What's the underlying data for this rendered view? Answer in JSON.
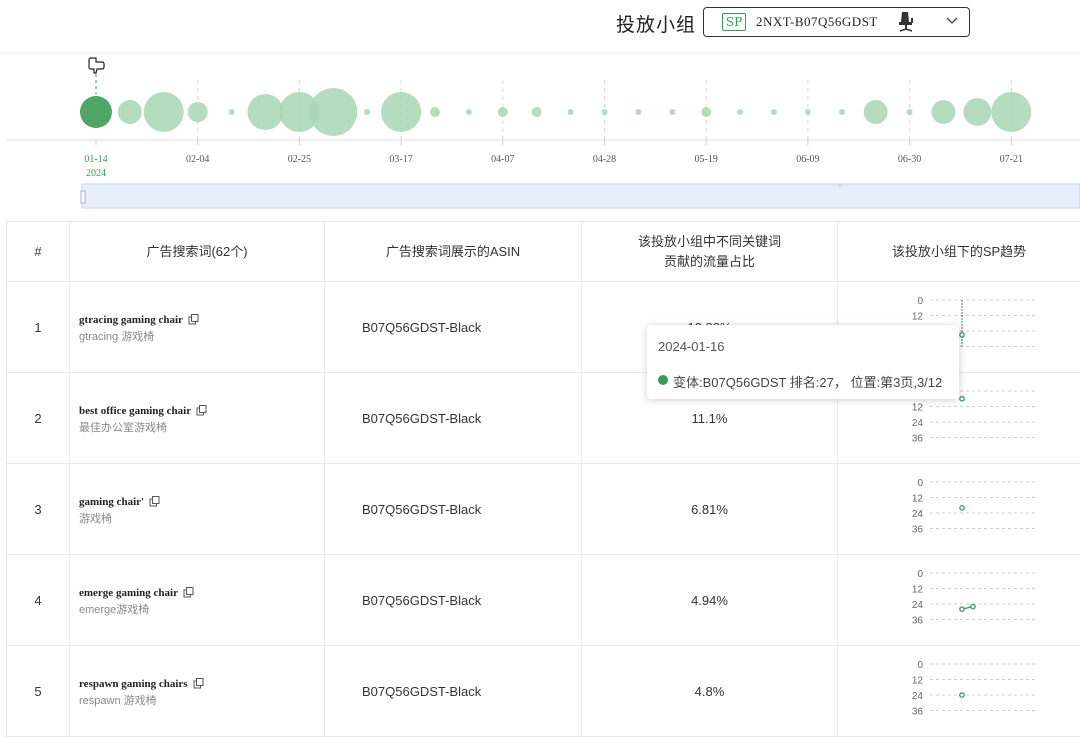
{
  "header": {
    "label": "投放小组",
    "group_badge": "SP",
    "group_name": "2NXT-B07Q56GDST",
    "group_icon": "gaming-chair-icon",
    "dropdown_icon": "chevron-down-icon"
  },
  "timeline": {
    "date_ticks": [
      "01-14",
      "02-04",
      "02-25",
      "03-17",
      "04-07",
      "04-28",
      "05-19",
      "06-09",
      "06-30",
      "07-21"
    ],
    "year_label": "2024",
    "selected_tick": "01-14",
    "bubbles": [
      6,
      4,
      8,
      3,
      1,
      7,
      8,
      10,
      1,
      8,
      2,
      1,
      2,
      2,
      1,
      1,
      1,
      1,
      2,
      1,
      1,
      1,
      1,
      4,
      1,
      4,
      5,
      8
    ],
    "colors": {
      "accent": "#3a9a5a",
      "bubble": "#a9d6b5",
      "selected": "#4ea565"
    }
  },
  "table": {
    "headers": {
      "index": "#",
      "keyword": "广告搜索词(62个)",
      "asin": "广告搜索词展示的ASIN",
      "share_line1": "该投放小组中不同关键词",
      "share_line2": "贡献的流量占比",
      "trend": "该投放小组下的SP趋势"
    },
    "trend_axis_ticks": [
      "0",
      "12",
      "24",
      "36"
    ],
    "rows": [
      {
        "index": "1",
        "keyword": "gtracing gaming chair",
        "keyword_cn": "gtracing 游戏椅",
        "asin": "B07Q56GDST-Black",
        "share": "13.88%",
        "trend": [
          27
        ]
      },
      {
        "index": "2",
        "keyword": "best office gaming chair",
        "keyword_cn": "最佳办公室游戏椅",
        "asin": "B07Q56GDST-Black",
        "share": "11.1%",
        "trend": [
          6
        ]
      },
      {
        "index": "3",
        "keyword": "gaming chair'",
        "keyword_cn": "游戏椅",
        "asin": "B07Q56GDST-Black",
        "share": "6.81%",
        "trend": [
          20
        ]
      },
      {
        "index": "4",
        "keyword": "emerge gaming chair",
        "keyword_cn": "emerge游戏椅",
        "asin": "B07Q56GDST-Black",
        "share": "4.94%",
        "trend": [
          28,
          26
        ]
      },
      {
        "index": "5",
        "keyword": "respawn gaming chairs",
        "keyword_cn": "respawn 游戏椅",
        "asin": "B07Q56GDST-Black",
        "share": "4.8%",
        "trend": [
          24
        ]
      }
    ]
  },
  "tooltip": {
    "date": "2024-01-16",
    "text": "变体:B07Q56GDST  排名:27，  位置:第3页,3/12"
  }
}
